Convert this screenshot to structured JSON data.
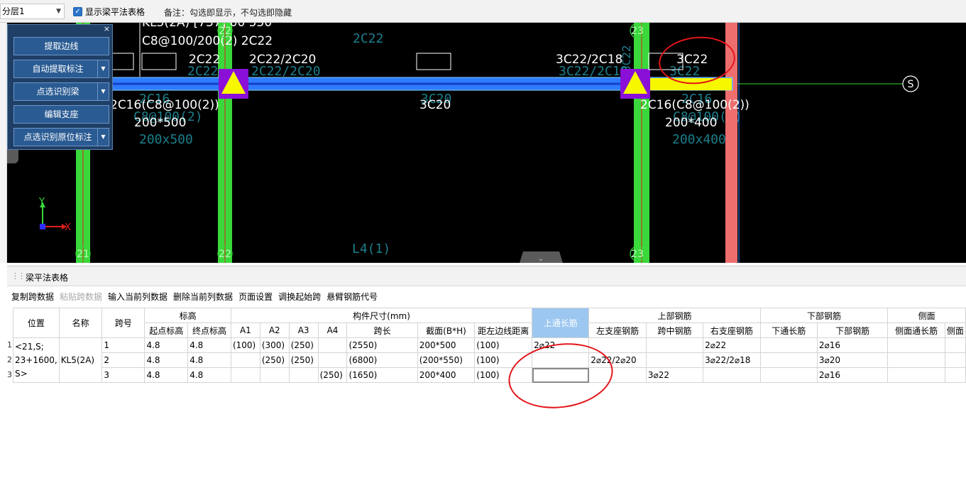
{
  "toolbar": {
    "layer_value": "分层1",
    "show_table_label": "显示梁平法表格",
    "show_table_checked": true,
    "remark": "备注：勾选即显示，不勾选即隐藏"
  },
  "tool_panel": {
    "close_glyph": "×",
    "buttons": [
      {
        "label": "提取边线",
        "dropdown": false
      },
      {
        "label": "自动提取标注",
        "dropdown": true
      },
      {
        "label": "点选识别梁",
        "dropdown": true
      },
      {
        "label": "编辑支座",
        "dropdown": false
      },
      {
        "label": "点选识别原位标注",
        "dropdown": true
      }
    ]
  },
  "cad": {
    "axes": {
      "top": [
        "22",
        "23"
      ],
      "bottom": [
        "21",
        "22",
        "23"
      ],
      "right": "S"
    },
    "texts": {
      "beam_title": "KL5(2A) [737] 00 550",
      "stirrup": "C8@100/200(2) 2C22",
      "left_top": "2C22",
      "mid_support": "2C22/2C20",
      "right_support": "3C22/2C18",
      "cant_top": "3C22",
      "span1_bottom": "2C16(C8@100(2))",
      "span1_section": "200*500",
      "span2_bottom": "3C20",
      "span3_bottom": "2C16(C8@100(2))",
      "span3_section": "200*400",
      "ghost_2c22": "2C22",
      "ghost_2c22_2c20": "2C22/2C20",
      "ghost_3c22_2c18": "3C22/2C18",
      "ghost_3c22": "3C22",
      "ghost_2c16": "2C16",
      "ghost_c8": "C8@100(2)",
      "ghost_200x500": "200x500",
      "ghost_3c20": "3C20",
      "ghost_200x400": "200x400",
      "ghost_top": "2C22",
      "ghost_vertical": "3C22",
      "l4": "L4(1)",
      "axis_y": "Y",
      "axis_x": "X"
    },
    "colors": {
      "beam": "#3a8cff",
      "column": "#3ad83a",
      "support": "#8a10d8",
      "triangle": "#f7f700",
      "wall": "#ee6e6e",
      "ghost": "#1c7f8c"
    }
  },
  "bottom_panel": {
    "title": "梁平法表格",
    "actions": [
      {
        "label": "复制跨数据",
        "enabled": true
      },
      {
        "label": "粘贴跨数据",
        "enabled": false
      },
      {
        "label": "输入当前列数据",
        "enabled": true
      },
      {
        "label": "删除当前列数据",
        "enabled": true
      },
      {
        "label": "页面设置",
        "enabled": true
      },
      {
        "label": "调换起始跨",
        "enabled": true
      },
      {
        "label": "悬臂钢筋代号",
        "enabled": true
      }
    ],
    "table": {
      "h_position": "位置",
      "h_name": "名称",
      "h_span": "跨号",
      "h_elevation": "标高",
      "h_start_elev": "起点标高",
      "h_end_elev": "终点标高",
      "h_dims": "构件尺寸(mm)",
      "h_a1": "A1",
      "h_a2": "A2",
      "h_a3": "A3",
      "h_a4": "A4",
      "h_span_len": "跨长",
      "h_section": "截面(B*H)",
      "h_offset": "距左边线距离",
      "h_top_through": "上通长筋",
      "h_top_rebar": "上部钢筋",
      "h_left_support": "左支座钢筋",
      "h_mid_rebar": "跨中钢筋",
      "h_right_support": "右支座钢筋",
      "h_bottom_rebar_group": "下部钢筋",
      "h_bottom_through": "下通长筋",
      "h_bottom_rebar": "下部钢筋",
      "h_side": "侧面",
      "h_side_through": "侧面通长筋",
      "h_side_cut": "侧面",
      "row_numbers": [
        "1",
        "2",
        "3"
      ],
      "position": "<21,S;\n23+1600,\nS>",
      "name": "KL5(2A)",
      "rows": [
        {
          "span": "1",
          "start": "4.8",
          "end": "4.8",
          "a1": "(100)",
          "a2": "(300)",
          "a3": "(250)",
          "a4": "",
          "len": "(2550)",
          "section": "200*500",
          "offset": "(100)",
          "top_through": "2⌀22",
          "left": "",
          "mid": "",
          "right": "2⌀22",
          "bot_through": "",
          "bot": "2⌀16",
          "side": ""
        },
        {
          "span": "2",
          "start": "4.8",
          "end": "4.8",
          "a1": "",
          "a2": "(250)",
          "a3": "(250)",
          "a4": "",
          "len": "(6800)",
          "section": "(200*550)",
          "offset": "(100)",
          "top_through": "",
          "left": "2⌀22/2⌀20",
          "mid": "",
          "right": "3⌀22/2⌀18",
          "bot_through": "",
          "bot": "3⌀20",
          "side": ""
        },
        {
          "span": "3",
          "start": "4.8",
          "end": "4.8",
          "a1": "",
          "a2": "",
          "a3": "",
          "a4": "(250)",
          "len": "(1650)",
          "section": "200*400",
          "offset": "(100)",
          "top_through": "",
          "left": "",
          "mid": "3⌀22",
          "right": "",
          "bot_through": "",
          "bot": "2⌀16",
          "side": ""
        }
      ]
    }
  }
}
